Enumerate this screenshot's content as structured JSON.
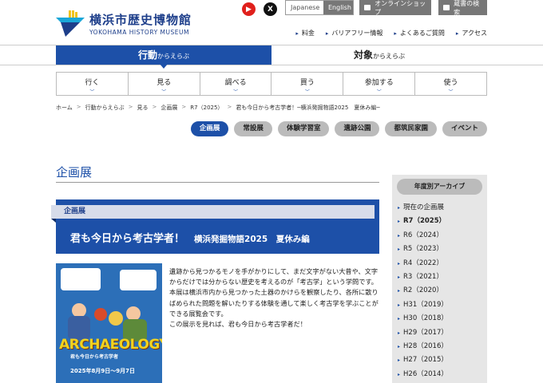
{
  "header": {
    "logo_jp": "横浜市歴史博物館",
    "logo_en": "YOKOHAMA HISTORY MUSEUM",
    "sns": [
      {
        "name": "youtube-icon",
        "label": "▶"
      },
      {
        "name": "x-icon",
        "label": "X"
      }
    ],
    "lang_ja": "Japanese",
    "lang_en": "English",
    "shop_label": "オンラインショップ",
    "library_label": "蔵書の検索",
    "util_links": [
      "料金",
      "バリアフリー情報",
      "よくあるご質問",
      "アクセス"
    ]
  },
  "tabs": {
    "active_main": "行動",
    "active_sub": "からえらぶ",
    "inactive_main": "対象",
    "inactive_sub": "からえらぶ"
  },
  "catnav": [
    "行く",
    "見る",
    "調べる",
    "買う",
    "参加する",
    "使う"
  ],
  "breadcrumb": [
    "ホーム",
    "行動からえらぶ",
    "見る",
    "企画展",
    "R7（2025）",
    "君も今日から考古学者！─横浜発掘物語2025　夏休み編─"
  ],
  "pills": [
    "企画展",
    "常設展",
    "体験学習室",
    "遺跡公園",
    "都筑民家園",
    "イベント"
  ],
  "page_title": "企画展",
  "banner": {
    "label": "企画展",
    "title": "君も今日から考古学者！",
    "subtitle": "横浜発掘物語2025　夏休み編"
  },
  "poster": {
    "title": "ARCHAEOLOGY",
    "sub": "君も今日から考古学者",
    "date": "2025年8月9日〜9月7日"
  },
  "description": "遺跡から見つかるモノを手がかりにして、まだ文字がない大昔や、文字からだけでは分からない歴史を考えるのが「考古学」という学問です。本展は横浜市内から見つかった土器のかけらを観察したり、各所に散りばめられた問題を解いたりする体験を通して楽しく考古学を学ぶことができる展覧会です。\nこの展示を見れば、君も今日から考古学者だ！",
  "sidebar": {
    "heading": "年度別アーカイブ",
    "items": [
      "現在の企画展",
      "R7（2025）",
      "R6（2024）",
      "R5（2023）",
      "R4（2022）",
      "R3（2021）",
      "R2（2020）",
      "H31（2019）",
      "H30（2018）",
      "H29（2017）",
      "H28（2016）",
      "H27（2015）",
      "H26（2014）"
    ],
    "current_index": 1
  },
  "colors": {
    "brand": "#1d50a8",
    "navy": "#1d3e8a"
  }
}
